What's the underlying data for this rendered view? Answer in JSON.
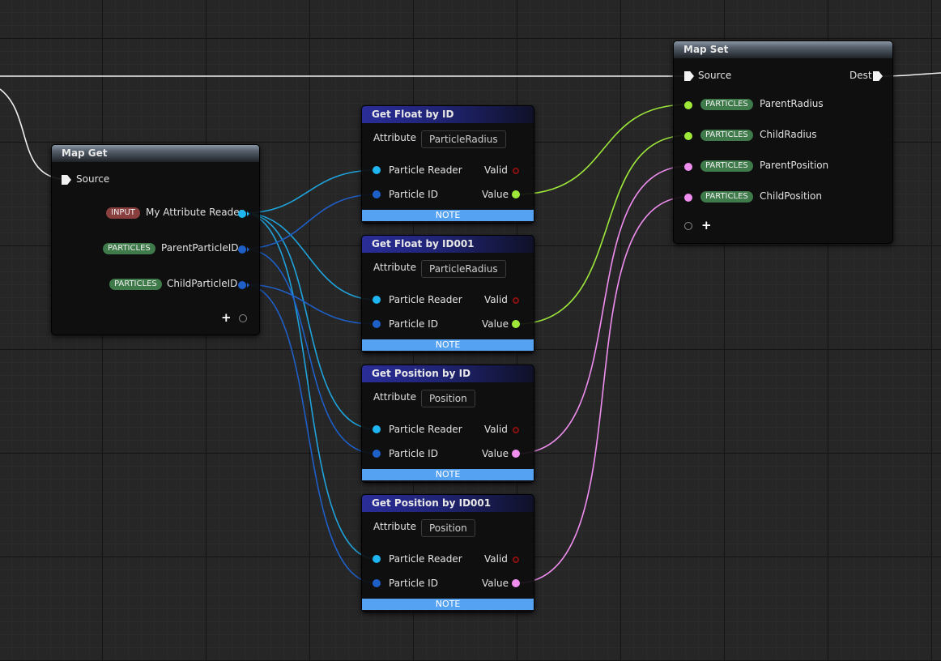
{
  "map_get": {
    "title": "Map Get",
    "source_label": "Source",
    "outputs": [
      {
        "badge": "INPUT",
        "label": "My Attribute Reader"
      },
      {
        "badge": "PARTICLES",
        "label": "ParentParticleID"
      },
      {
        "badge": "PARTICLES",
        "label": "ChildParticleID"
      }
    ]
  },
  "id_nodes": [
    {
      "title": "Get Float by ID",
      "attribute_label": "Attribute",
      "attribute_value": "ParticleRadius",
      "reader_label": "Particle Reader",
      "id_label": "Particle ID",
      "valid_label": "Valid",
      "value_label": "Value",
      "note": "NOTE"
    },
    {
      "title": "Get Float by ID001",
      "attribute_label": "Attribute",
      "attribute_value": "ParticleRadius",
      "reader_label": "Particle Reader",
      "id_label": "Particle ID",
      "valid_label": "Valid",
      "value_label": "Value",
      "note": "NOTE"
    },
    {
      "title": "Get Position by ID",
      "attribute_label": "Attribute",
      "attribute_value": "Position",
      "reader_label": "Particle Reader",
      "id_label": "Particle ID",
      "valid_label": "Valid",
      "value_label": "Value",
      "note": "NOTE"
    },
    {
      "title": "Get Position by ID001",
      "attribute_label": "Attribute",
      "attribute_value": "Position",
      "reader_label": "Particle Reader",
      "id_label": "Particle ID",
      "valid_label": "Valid",
      "value_label": "Value",
      "note": "NOTE"
    }
  ],
  "map_set": {
    "title": "Map Set",
    "source_label": "Source",
    "dest_label": "Dest",
    "inputs": [
      {
        "badge": "PARTICLES",
        "label": "ParentRadius"
      },
      {
        "badge": "PARTICLES",
        "label": "ChildRadius"
      },
      {
        "badge": "PARTICLES",
        "label": "ParentPosition"
      },
      {
        "badge": "PARTICLES",
        "label": "ChildPosition"
      }
    ]
  },
  "colors": {
    "reader_pin": "#1fb5f0",
    "id_pin": "#1e5fc8",
    "float_pin": "#9ee83a",
    "position_pin": "#f08ef0",
    "valid_pin": "#8a1010",
    "note_bar": "#56a2f2",
    "exec_wire": "#f0f0f0"
  },
  "icons": [
    "exec-pin-icon",
    "add-pin-icon",
    "plus-icon"
  ]
}
